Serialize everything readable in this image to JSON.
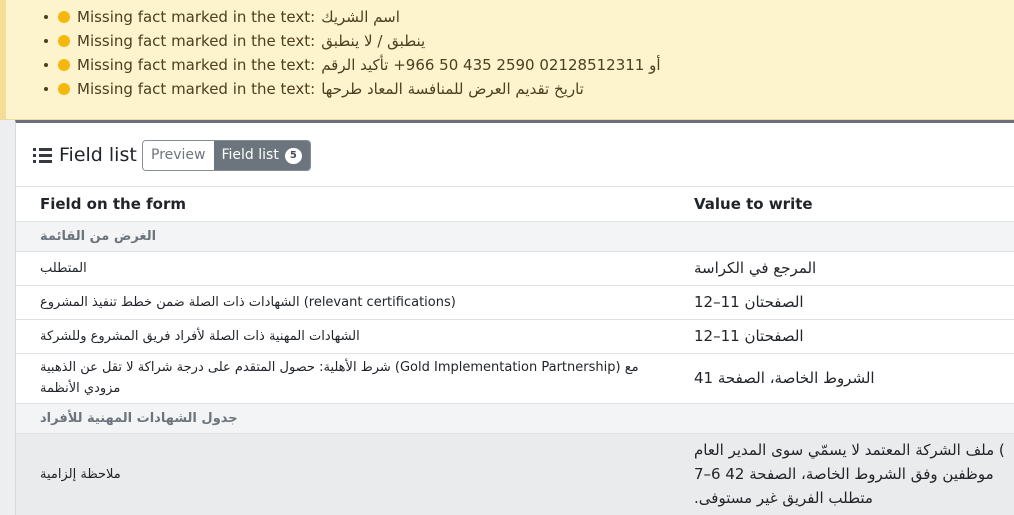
{
  "warnings": {
    "label": "Missing fact marked in the text:",
    "items": [
      "اسم الشريك",
      "ينطبق / لا ينطبق",
      "تأكيد الرقم ‎+966 50 435 2590‎ أو 02128512311",
      "تاريخ تقديم العرض للمنافسة المعاد طرحها"
    ]
  },
  "panel": {
    "title": "Field list",
    "tabs": {
      "preview": "Preview",
      "field_list": "Field list",
      "field_list_count": "5"
    }
  },
  "table": {
    "headers": {
      "field": "Field on the form",
      "value": "Value to write"
    },
    "section1": "الغرض من القائمة",
    "rows": [
      {
        "field": "المتطلب",
        "value": "المرجع في الكراسة"
      },
      {
        "field": "الشهادات ذات الصلة ضمن خطط تنفيذ المشروع (relevant certifications)",
        "value": "الصفحتان 11–12"
      },
      {
        "field": "الشهادات المهنية ذات الصلة لأفراد فريق المشروع وللشركة",
        "value": "الصفحتان 11–12"
      },
      {
        "field_line1": "شرط الأهلية: حصول المتقدم على درجة شراكة لا تقل عن الذهبية (Gold Implementation Partnership) مع",
        "field_line2": "مزودي الأنظمة",
        "value": "الشروط الخاصة، الصفحة 41"
      }
    ],
    "section2": "جدول الشهادات المهنية للأفراد",
    "note": {
      "field": "ملاحظة إلزامية",
      "value_lines": [
        "ملف الشركة المعتمد لا يسمّي سوى المدير العام (",
        "7–6 موظفين وفق الشروط الخاصة، الصفحة 42",
        ".متطلب الفريق غير مستوفى"
      ]
    }
  }
}
